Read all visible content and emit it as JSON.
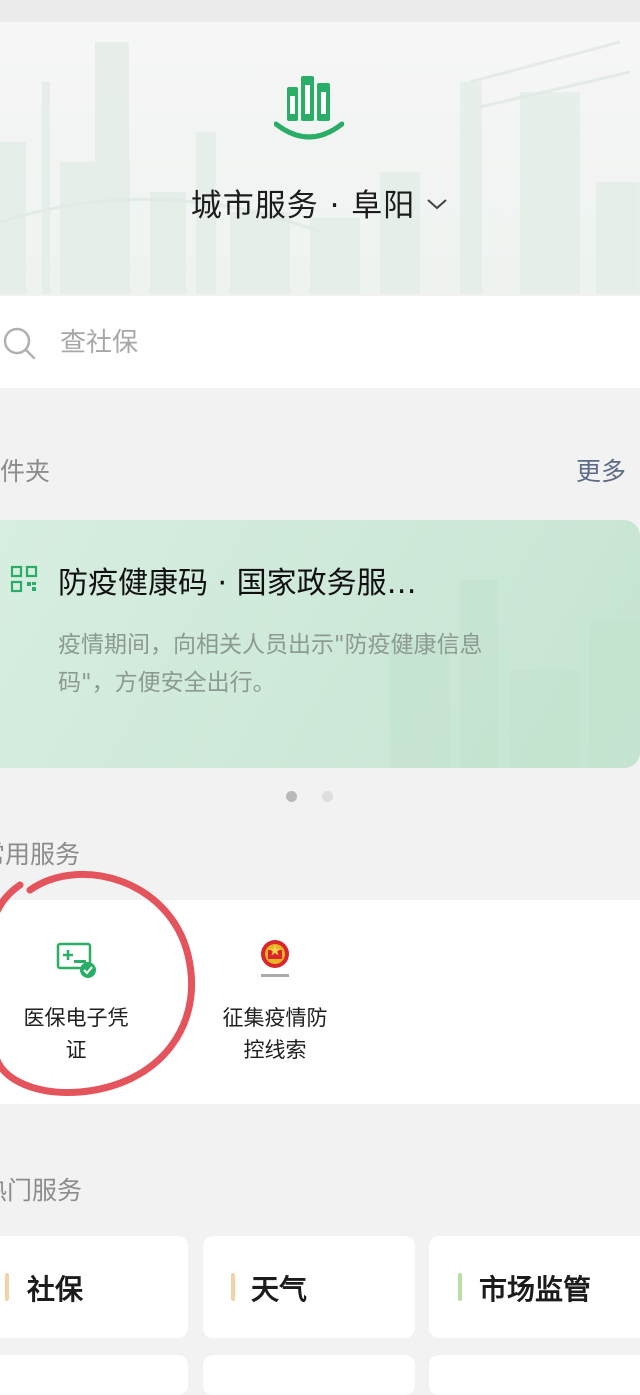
{
  "header": {
    "title": "城市服务 · 阜阳",
    "logo_icon": "city-buildings-logo-icon",
    "dropdown_icon": "chevron-down-icon"
  },
  "search": {
    "placeholder": "查社保",
    "icon": "search-icon"
  },
  "folder": {
    "label": "证件夹",
    "more_label": "更多",
    "card": {
      "icon": "qr-code-icon",
      "title": "防疫健康码 · 国家政务服…",
      "description": "疫情期间，向相关人员出示\"防疫健康信息码\"，方便安全出行。"
    },
    "pager": {
      "count": 2,
      "active": 0
    }
  },
  "common_services": {
    "label": "常用服务",
    "items": [
      {
        "label": "医保电子凭证",
        "icon": "medical-insurance-card-icon"
      },
      {
        "label": "征集疫情防控线索",
        "icon": "national-emblem-icon"
      }
    ]
  },
  "hot_services": {
    "label": "热门服务",
    "items": [
      {
        "label": "社保",
        "accent": "#f0d3a6"
      },
      {
        "label": "天气",
        "accent": "#f0d3a6"
      },
      {
        "label": "市场监管",
        "accent": "#b9e0a4"
      }
    ]
  },
  "colors": {
    "brand_green": "#2aae67",
    "annotation_red": "#e4545c",
    "link_blue": "#5d6b86"
  }
}
